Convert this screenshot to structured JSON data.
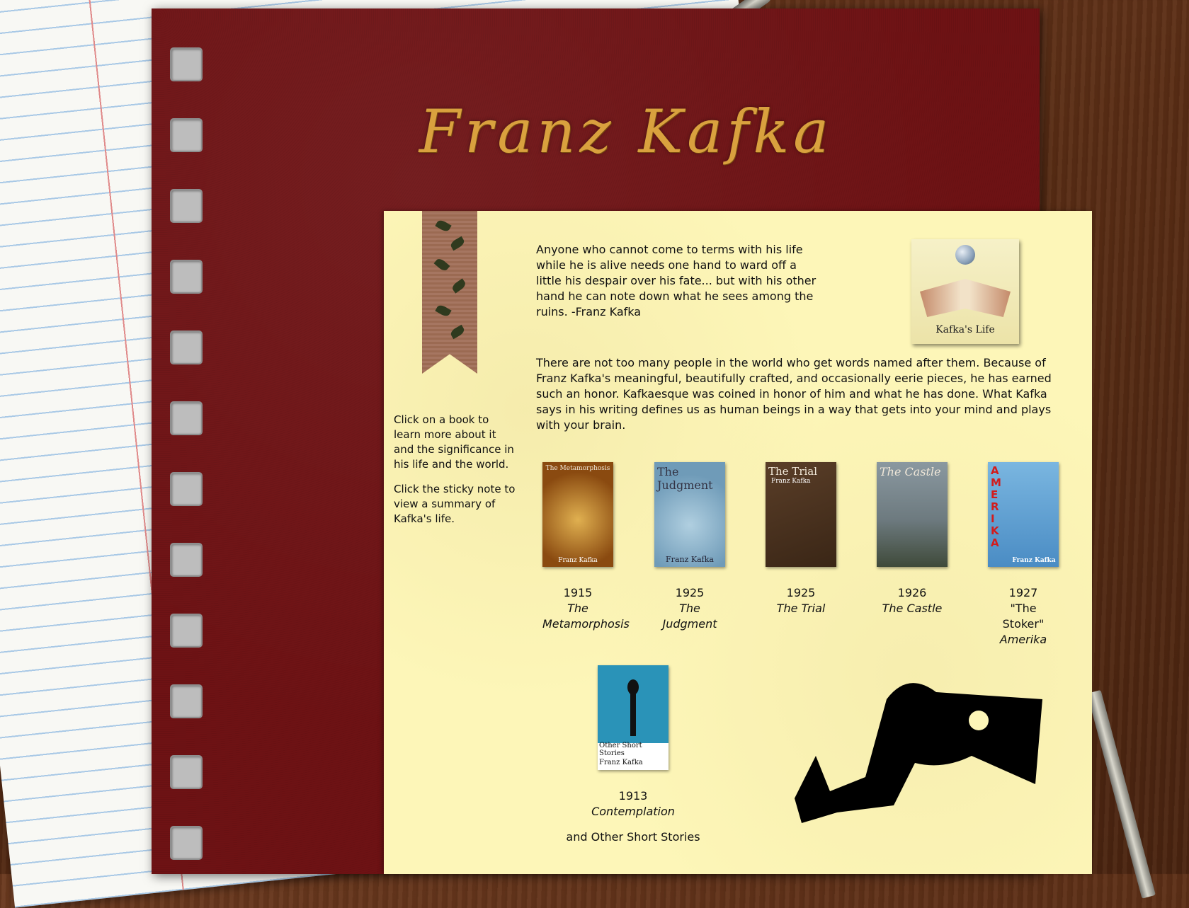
{
  "cover": {
    "title": "Franz Kafka"
  },
  "sidebar": {
    "instruction_books": "Click on a book to learn more about it and the significance in his life and the world.",
    "instruction_note": "Click the sticky note to view a summary of Kafka's life."
  },
  "quote": "Anyone who cannot come to terms with his life while he is alive needs one hand to ward off a little his despair over his fate... but with his other hand he can note down what he sees among the ruins. -Franz Kafka",
  "intro": "There are not too many people in the world who get words named after them. Because of Franz Kafka's meaningful, beautifully crafted, and occasionally eerie pieces, he has earned such an honor. Kafkaesque was coined in honor of him and what he has done. What Kafka says in his writing defines us as human beings in a way that gets into your mind and plays with your brain.",
  "sticky_note": {
    "label": "Kafka's Life",
    "icon": "open-book-globe-icon"
  },
  "books": [
    {
      "year": "1915",
      "title": "The Metamorphosis",
      "cover_title": "The Metamorphosis",
      "cover_author": "Franz Kafka",
      "color": "#9a5a12"
    },
    {
      "year": "1925",
      "title": "The Judgment",
      "cover_title": "The Judgment",
      "cover_author": "Franz Kafka",
      "color": "#6f9bb8"
    },
    {
      "year": "1925",
      "title": "The Trial",
      "cover_title": "The Trial",
      "cover_author": "Franz Kafka",
      "color": "#4b3422"
    },
    {
      "year": "1926",
      "title": "The Castle",
      "cover_title": "The Castle",
      "cover_author": "",
      "color": "#5c6e75"
    },
    {
      "year": "1927",
      "title_prefix": "\"The Stoker\"",
      "title": "Amerika",
      "cover_title": "AMERIKA",
      "cover_author": "Franz Kafka",
      "color": "#5aa0d6"
    }
  ],
  "contemplation": {
    "year": "1913",
    "title": "Contemplation",
    "subtitle": "and Other Short Stories",
    "cover_title": "Other Short Stories",
    "cover_author": "Franz Kafka",
    "color": "#2a93b8"
  }
}
